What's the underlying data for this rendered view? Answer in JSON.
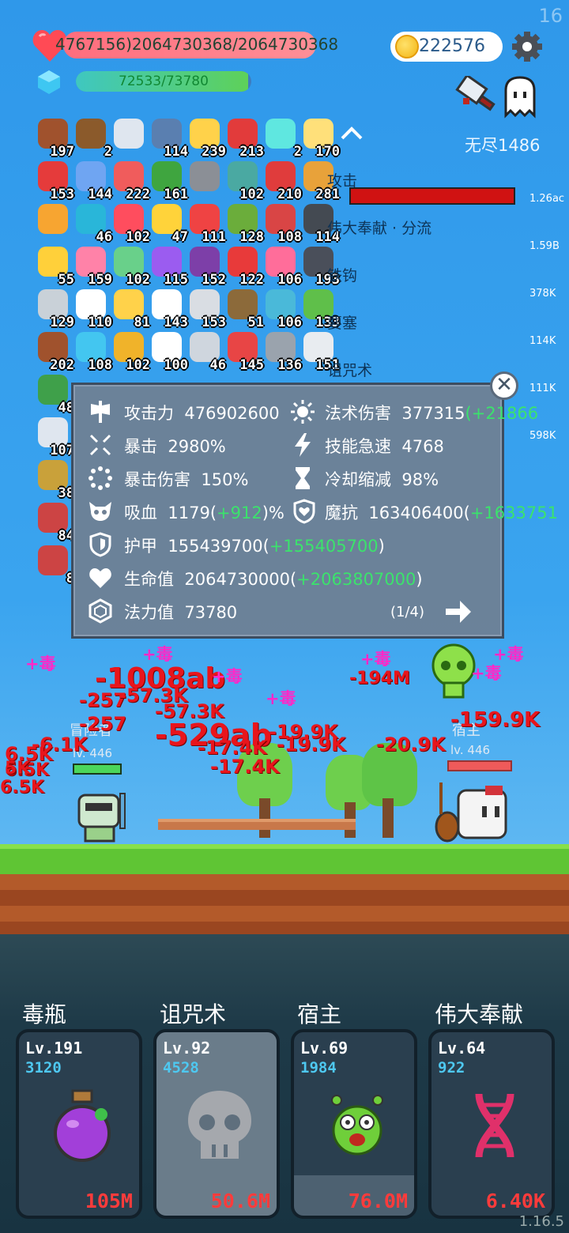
{
  "corner_number": "16",
  "version": "1.16.5",
  "hp": {
    "text": "4767156)2064730368/2064730368",
    "icon": "heart-icon",
    "level": 1.0
  },
  "mp": {
    "text": "72533/73780",
    "icon": "crystal-icon",
    "level": 0.98
  },
  "coins": {
    "value": "222576",
    "icon": "coin-icon"
  },
  "mode_label": "无尽1486",
  "inventory": [
    {
      "count": "197",
      "color": "#a0522d"
    },
    {
      "count": "2",
      "color": "#8b5a2b"
    },
    {
      "count": "",
      "color": "#dfe6ef"
    },
    {
      "count": "114",
      "color": "#5a7fb0"
    },
    {
      "count": "239",
      "color": "#ffd24a"
    },
    {
      "count": "213",
      "color": "#e23b3b"
    },
    {
      "count": "2",
      "color": "#5fe7e0"
    },
    {
      "count": "170",
      "color": "#ffe07a"
    },
    {
      "count": "153",
      "color": "#e53b3b"
    },
    {
      "count": "144",
      "color": "#6fa5f2"
    },
    {
      "count": "222",
      "color": "#f05c5c"
    },
    {
      "count": "161",
      "color": "#3fa53f"
    },
    {
      "count": "",
      "color": "#8b8f96"
    },
    {
      "count": "102",
      "color": "#4aa9a2"
    },
    {
      "count": "210",
      "color": "#e03c3c"
    },
    {
      "count": "281",
      "color": "#e8a23a"
    },
    {
      "count": "",
      "color": "#f7a531"
    },
    {
      "count": "46",
      "color": "#29b6d9"
    },
    {
      "count": "102",
      "color": "#ff4d5e"
    },
    {
      "count": "47",
      "color": "#ffd33a"
    },
    {
      "count": "111",
      "color": "#ef4343"
    },
    {
      "count": "128",
      "color": "#6bad3b"
    },
    {
      "count": "108",
      "color": "#d94545"
    },
    {
      "count": "114",
      "color": "#444a52"
    },
    {
      "count": "55",
      "color": "#ffd03a"
    },
    {
      "count": "159",
      "color": "#ff82a8"
    },
    {
      "count": "102",
      "color": "#69d08a"
    },
    {
      "count": "115",
      "color": "#9b5cf0"
    },
    {
      "count": "152",
      "color": "#7d3fa8"
    },
    {
      "count": "122",
      "color": "#e83a3a"
    },
    {
      "count": "106",
      "color": "#ff6d9a"
    },
    {
      "count": "193",
      "color": "#4a4f5a"
    },
    {
      "count": "129",
      "color": "#c9d1d8"
    },
    {
      "count": "110",
      "color": "#ffffff"
    },
    {
      "count": "81",
      "color": "#ffd24a"
    },
    {
      "count": "143",
      "color": "#ffffff"
    },
    {
      "count": "153",
      "color": "#d9dde3"
    },
    {
      "count": "51",
      "color": "#8c6a3a"
    },
    {
      "count": "106",
      "color": "#4ab9d9"
    },
    {
      "count": "133",
      "color": "#5fbf4a"
    },
    {
      "count": "202",
      "color": "#a0522d"
    },
    {
      "count": "108",
      "color": "#43c6f0"
    },
    {
      "count": "102",
      "color": "#f0b32a"
    },
    {
      "count": "100",
      "color": "#ffffff"
    },
    {
      "count": "46",
      "color": "#cfd6de"
    },
    {
      "count": "145",
      "color": "#e84545"
    },
    {
      "count": "136",
      "color": "#9aa3ad"
    },
    {
      "count": "151",
      "color": "#e8ecf0"
    },
    {
      "count": "48",
      "color": "#3fa04a"
    },
    {
      "count": "107",
      "color": "#dfe6ef"
    },
    {
      "count": "38",
      "color": "#c9a13a"
    },
    {
      "count": "84",
      "color": "#c44"
    },
    {
      "count": "8",
      "color": "#c44"
    }
  ],
  "damage_list": [
    {
      "name": "攻击",
      "value": "1.26ac"
    },
    {
      "name": "伟大奉献 · 分流",
      "value": "1.59B"
    },
    {
      "name": "铁钩",
      "value": "378K"
    },
    {
      "name": "要塞",
      "value": "114K"
    },
    {
      "name": "诅咒术",
      "value": "111K"
    },
    {
      "name": "",
      "value": "598K"
    }
  ],
  "stats_panel": {
    "attack": {
      "label": "攻击力",
      "value": "476902600",
      "bonus": ""
    },
    "magic": {
      "label": "法术伤害",
      "value": "377315",
      "bonus": "(+21866"
    },
    "crit": {
      "label": "暴击",
      "value": "2980%"
    },
    "haste": {
      "label": "技能急速",
      "value": "4768"
    },
    "crit_dmg": {
      "label": "暴击伤害",
      "value": "150%"
    },
    "cdr": {
      "label": "冷却缩减",
      "value": "98%"
    },
    "lifesteal": {
      "label": "吸血",
      "value": "1179",
      "bonus": "+912",
      "suffix": "%"
    },
    "mres": {
      "label": "魔抗",
      "value": "163406400",
      "bonus": "+1633751"
    },
    "armor": {
      "label": "护甲",
      "value": "155439700",
      "bonus": "+155405700"
    },
    "hp": {
      "label": "生命值",
      "value": "2064730000",
      "bonus": "+2063807000"
    },
    "mana": {
      "label": "法力值",
      "value": "73780"
    },
    "page": "(1/4)"
  },
  "battle": {
    "hero_name": "冒险者",
    "hero_level": "lv. 446",
    "enemy_name": "宿主",
    "enemy_level": "lv. 446",
    "floats": [
      {
        "text": "-1008ab"
      },
      {
        "text": "-257"
      },
      {
        "text": "-57.3K"
      },
      {
        "text": "-257"
      },
      {
        "text": "-57.3K"
      },
      {
        "text": "-529ab"
      },
      {
        "text": "-19.9K"
      },
      {
        "text": "-17.4K"
      },
      {
        "text": "-19.9K"
      },
      {
        "text": "-17.4K"
      },
      {
        "text": "-20.9K"
      },
      {
        "text": "-194M"
      },
      {
        "text": "-159.9K"
      },
      {
        "text": "-6.1K"
      },
      {
        "text": "6.5K"
      },
      {
        "text": "6.5K"
      },
      {
        "text": "5K"
      },
      {
        "text": "6.5K"
      }
    ],
    "poison_label": "+毒"
  },
  "skills": [
    {
      "title": "毒瓶",
      "level": "Lv.191",
      "sub": "3120",
      "damage": "105M",
      "progress": 0.0
    },
    {
      "title": "诅咒术",
      "level": "Lv.92",
      "sub": "4528",
      "damage": "50.6M",
      "progress": 1.0
    },
    {
      "title": "宿主",
      "level": "Lv.69",
      "sub": "1984",
      "damage": "76.0M",
      "progress": 0.22
    },
    {
      "title": "伟大奉献",
      "level": "Lv.64",
      "sub": "922",
      "damage": "6.40K",
      "progress": 0.0
    }
  ]
}
